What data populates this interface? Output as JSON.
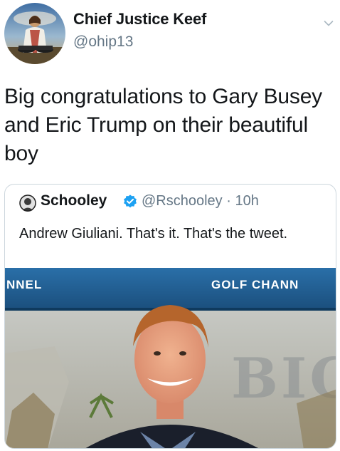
{
  "tweet": {
    "display_name": "Chief Justice Keef",
    "handle": "@ohip13",
    "text": "Big congratulations to Gary Busey and Eric Trump on their beautiful boy"
  },
  "quoted": {
    "display_name": "Schooley",
    "handle_time": "@Rschooley · 10h",
    "text": "Andrew Giuliani. That's it. That's the tweet.",
    "media": {
      "sign_left": "NNEL",
      "sign_right": "GOLF CHANN",
      "backdrop_letters": "BIG"
    }
  },
  "icons": {
    "caret": "chevron-down-icon",
    "verified": "verified-badge-icon"
  },
  "colors": {
    "text": "#14171a",
    "secondary": "#657786",
    "verified": "#1da1f2",
    "border": "#ccd6dd"
  }
}
